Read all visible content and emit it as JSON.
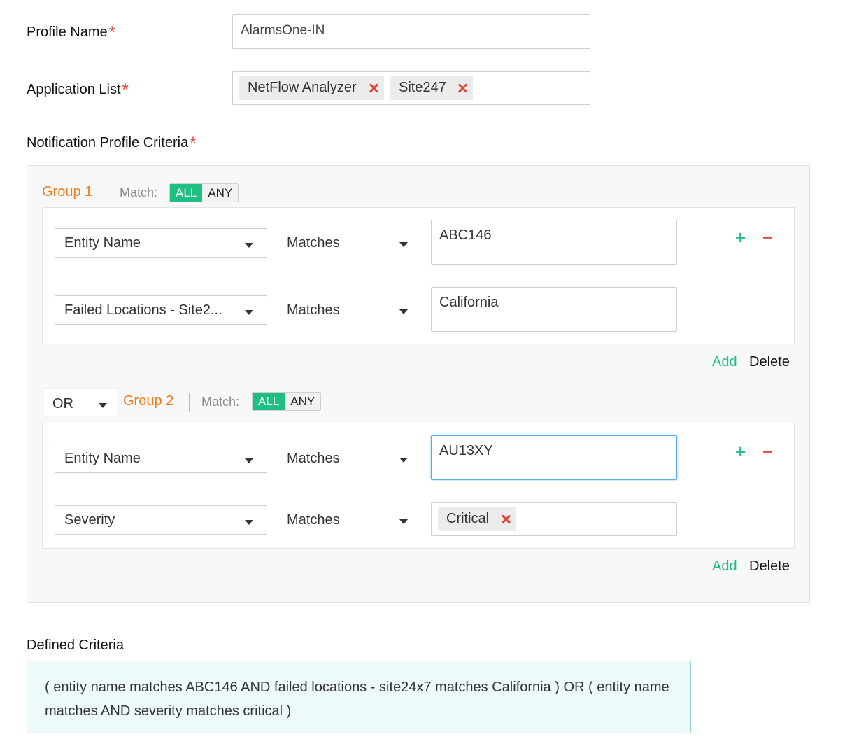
{
  "profile_name": {
    "label": "Profile Name",
    "value": "AlarmsOne-IN"
  },
  "application_list": {
    "label": "Application List",
    "chips": [
      "NetFlow Analyzer",
      "Site247"
    ]
  },
  "criteria": {
    "label": "Notification Profile Criteria",
    "match_label": "Match:",
    "all_label": "ALL",
    "any_label": "ANY",
    "add_label": "Add",
    "delete_label": "Delete",
    "plus_glyph": "+",
    "minus_glyph": "−",
    "group1": {
      "title": "Group 1",
      "rules": [
        {
          "field": "Entity Name",
          "operator": "Matches",
          "value": "ABC146"
        },
        {
          "field": "Failed Locations - Site2...",
          "operator": "Matches",
          "value": "California"
        }
      ]
    },
    "connector": "OR",
    "group2": {
      "title": "Group 2",
      "rules": [
        {
          "field": "Entity Name",
          "operator": "Matches",
          "value": "AU13XY"
        },
        {
          "field": "Severity",
          "operator": "Matches",
          "chip": "Critical"
        }
      ]
    }
  },
  "defined_criteria": {
    "label": "Defined Criteria",
    "text": "( entity name matches ABC146 AND failed locations - site24x7 matches California ) OR ( entity name matches AND severity matches critical )"
  },
  "colors": {
    "accent_green": "#1fbf83",
    "group_orange": "#f07b1d",
    "required_red": "#e2463d",
    "focus_blue": "#5aa8f0",
    "defined_bg": "#eefaf9",
    "defined_border": "#8fdad4"
  }
}
